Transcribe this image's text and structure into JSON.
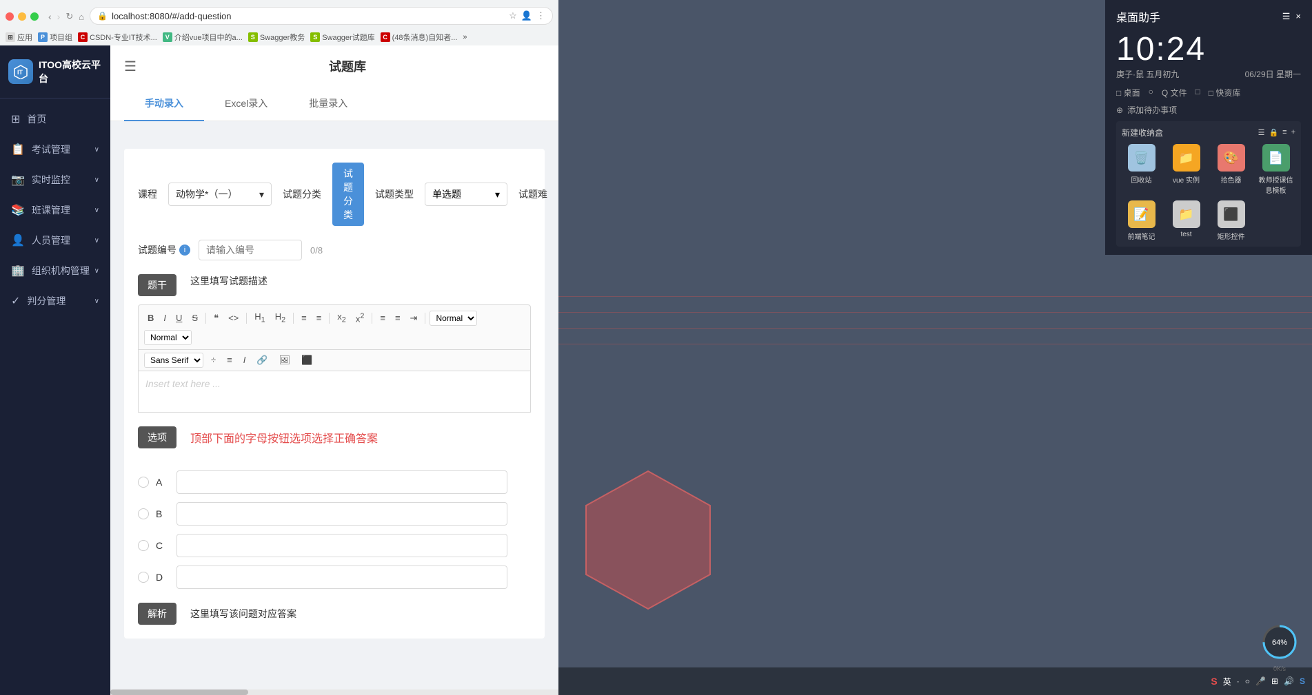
{
  "browser": {
    "url": "localhost:8080/#/add-question",
    "bookmarks": [
      {
        "label": "应用",
        "color": "#888"
      },
      {
        "label": "项目组",
        "color": "#4a90d9"
      },
      {
        "label": "CSDN-专业IT技术...",
        "color": "#c00"
      },
      {
        "label": "介绍vue项目中的a...",
        "color": "#2a7ae2"
      },
      {
        "label": "Swagger教务",
        "color": "#85be00"
      },
      {
        "label": "Swagger试题库",
        "color": "#85be00"
      },
      {
        "label": "(48条消息)自知者...",
        "color": "#c00"
      },
      {
        "label": "»",
        "color": "#888"
      }
    ]
  },
  "sidebar": {
    "logo": "ITOO高校云平台",
    "items": [
      {
        "label": "首页",
        "icon": "⊞",
        "active": false
      },
      {
        "label": "考试管理",
        "icon": "📋",
        "hasArrow": true
      },
      {
        "label": "实时监控",
        "icon": "📷",
        "hasArrow": true
      },
      {
        "label": "班课管理",
        "icon": "📚",
        "hasArrow": true
      },
      {
        "label": "人员管理",
        "icon": "👤",
        "hasArrow": true
      },
      {
        "label": "组织机构管理",
        "icon": "🏢",
        "hasArrow": true
      },
      {
        "label": "判分管理",
        "icon": "✓",
        "hasArrow": true
      }
    ]
  },
  "topbar": {
    "menu_icon": "☰",
    "title": "试题库"
  },
  "tabs": [
    {
      "label": "手动录入",
      "active": true
    },
    {
      "label": "Excel录入",
      "active": false
    },
    {
      "label": "批量录入",
      "active": false
    }
  ],
  "form": {
    "course_label": "课程",
    "course_value": "动物学*（一）",
    "category_label": "试题分类",
    "category_btn": "试题分类",
    "type_label": "试题类型",
    "type_value": "单选题",
    "difficulty_label": "试题难",
    "question_num_label": "试题编号",
    "question_num_placeholder": "请输入编号",
    "question_num_count": "0/8",
    "stem_btn": "题干",
    "stem_hint": "这里填写试题描述",
    "toolbar": {
      "bold": "B",
      "italic": "I",
      "underline": "U",
      "strikethrough": "S",
      "quote": "❝",
      "code": "<>",
      "h1": "H₁",
      "h2": "H₂",
      "ordered_list": "≡",
      "unordered_list": "≡",
      "sub": "x₂",
      "sup": "x²",
      "align_left": "≡",
      "align_right": "≡",
      "indent": "⇥",
      "font_select": "Normal",
      "heading_select": "Normal",
      "font_family": "Sans Serif",
      "font_size": "÷",
      "align": "≡",
      "italic2": "𝐼",
      "link": "🔗",
      "image": "🖼",
      "table": "⬛",
      "insert_placeholder": "Insert text here ..."
    },
    "options_btn": "选项",
    "options_hint": "顶部下面的字母按钮选项选择正确答案",
    "options": [
      {
        "letter": "A",
        "value": ""
      },
      {
        "letter": "B",
        "value": ""
      },
      {
        "letter": "C",
        "value": ""
      },
      {
        "letter": "D",
        "value": ""
      }
    ],
    "analysis_btn": "解析",
    "analysis_hint": "这里填写该问题对应答案"
  },
  "desktop": {
    "clock_title": "桌面助手",
    "time": "10:24",
    "date_left": "庚子·鼠  五月初九",
    "date_right": "06/29日  星期一",
    "actions": [
      "□桌面",
      "○",
      "Q文件",
      "□",
      "□快资库"
    ],
    "new_folder_title": "新建收纳盒",
    "folder_items": [
      {
        "label": "回收站",
        "color": "#a0c4e0"
      },
      {
        "label": "vue 实例",
        "color": "#f5a623"
      },
      {
        "label": "拾色器",
        "color": "#e8786e"
      },
      {
        "label": "教师授课信息模板",
        "color": "#4a9e6b"
      },
      {
        "label": "前端笔记",
        "color": "#e8b84b"
      },
      {
        "label": "test",
        "color": "#ddd"
      },
      {
        "label": "矩形控件",
        "color": "#ddd"
      }
    ],
    "progress": "64%"
  }
}
